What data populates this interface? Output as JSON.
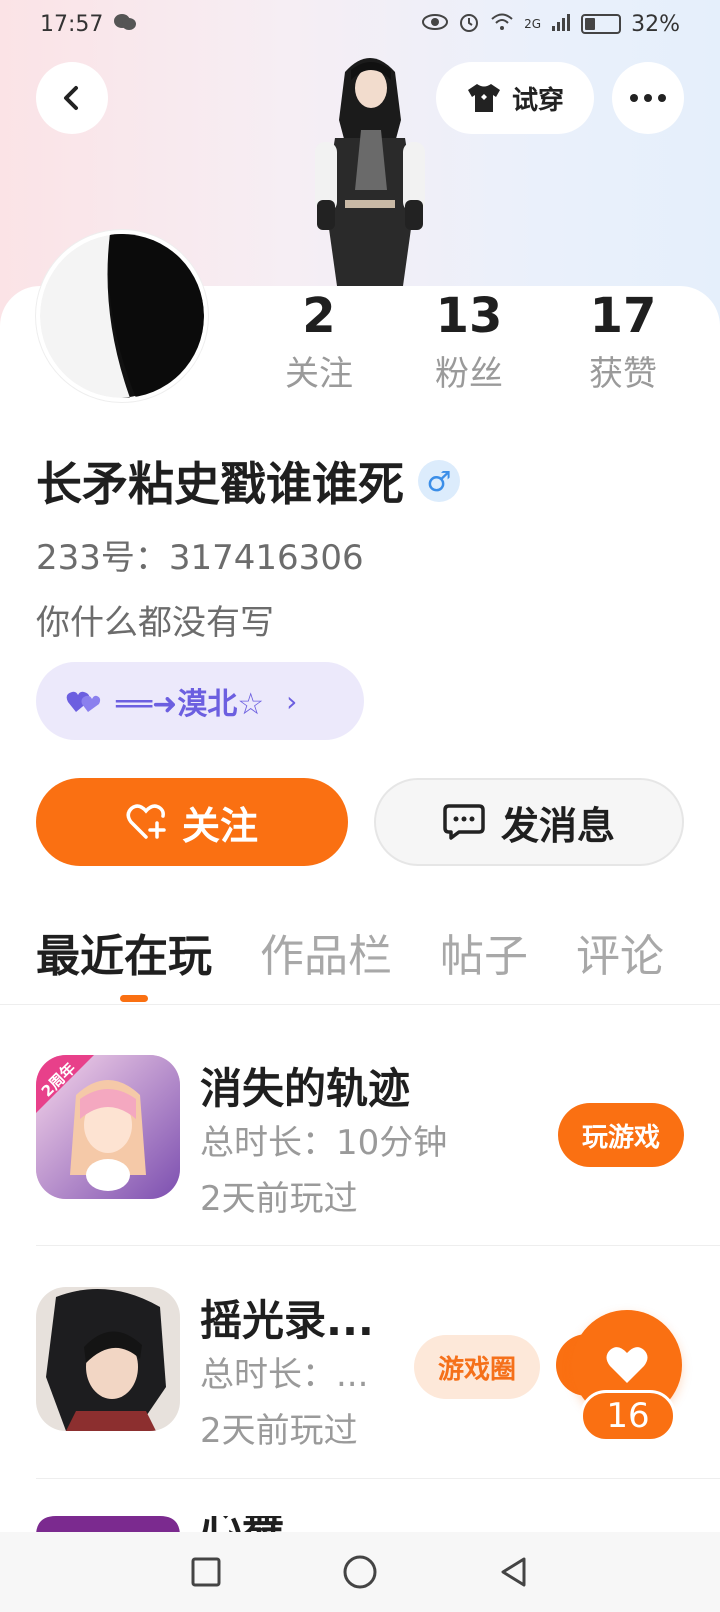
{
  "status_bar": {
    "time": "17:57",
    "network": "2G",
    "battery": "32%"
  },
  "header": {
    "tryon_label": "试穿"
  },
  "stats": [
    {
      "value": "2",
      "label": "关注"
    },
    {
      "value": "13",
      "label": "粉丝"
    },
    {
      "value": "17",
      "label": "获赞"
    }
  ],
  "profile": {
    "username": "长矛粘史戳谁谁死",
    "gender_symbol": "♂",
    "account_id": "233号：317416306",
    "bio": "你什么都没有写",
    "tag": "══➜漠北☆"
  },
  "actions": {
    "follow_label": "关注",
    "message_label": "发消息"
  },
  "tabs": [
    {
      "label": "最近在玩",
      "active": true
    },
    {
      "label": "作品栏",
      "active": false
    },
    {
      "label": "帖子",
      "active": false
    },
    {
      "label": "评论",
      "active": false
    }
  ],
  "games": [
    {
      "name": "消失的轨迹",
      "duration": "总时长：10分钟",
      "last_played": "2天前玩过",
      "button": "玩游戏",
      "badge": "2周年"
    },
    {
      "name": "摇光录...",
      "duration": "总时长：...",
      "last_played": "2天前玩过",
      "button": "游戏圈"
    }
  ],
  "partial_game": {
    "name": "心舞"
  },
  "like": {
    "count": "16"
  },
  "colors": {
    "accent": "#fa7012",
    "tag_bg": "#ece9fb",
    "tag_text": "#6c5fe0"
  }
}
